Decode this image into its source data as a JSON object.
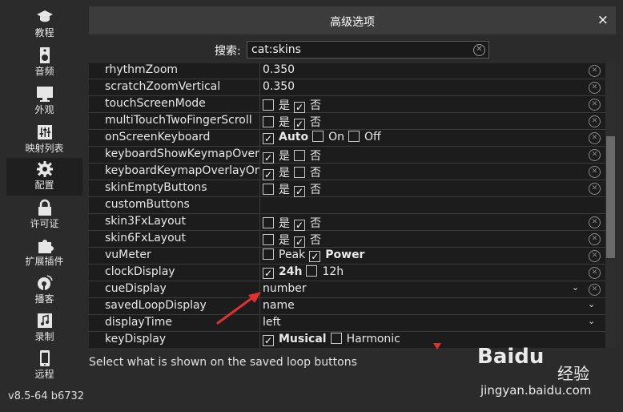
{
  "sidebar": {
    "items": [
      {
        "label": "教程",
        "icon": "graduation-cap-icon"
      },
      {
        "label": "音频",
        "icon": "speaker-icon"
      },
      {
        "label": "外观",
        "icon": "monitor-icon"
      },
      {
        "label": "映射列表",
        "icon": "sliders-icon"
      },
      {
        "label": "配置",
        "icon": "gear-icon",
        "active": true
      },
      {
        "label": "许可证",
        "icon": "lock-icon"
      },
      {
        "label": "扩展插件",
        "icon": "puzzle-icon"
      },
      {
        "label": "播客",
        "icon": "podcast-icon"
      },
      {
        "label": "录制",
        "icon": "music-note-icon"
      },
      {
        "label": "远程",
        "icon": "phone-icon"
      }
    ],
    "version": "v8.5-64 b6732"
  },
  "dialog": {
    "title": "高级选项",
    "close": "×"
  },
  "search": {
    "label": "搜索:",
    "value": "cat:skins"
  },
  "rows": [
    {
      "name": "rhythmZoom",
      "value": "0.350",
      "clear": true
    },
    {
      "name": "scratchZoomVertical",
      "value": "0.350",
      "clear": true
    },
    {
      "name": "touchScreenMode",
      "yes": "是",
      "no": "否",
      "checked": "no",
      "clear": true
    },
    {
      "name": "multiTouchTwoFingerScroll",
      "yes": "是",
      "no": "否",
      "checked": "no",
      "clear": true
    },
    {
      "name": "onScreenKeyboard",
      "options": [
        "Auto",
        "On",
        "Off"
      ],
      "checked": "Auto",
      "clear": true
    },
    {
      "name": "keyboardShowKeymapOverlay",
      "yes": "是",
      "no": "否",
      "checked": "yes",
      "clear": true
    },
    {
      "name": "keyboardKeymapOverlayOnShift",
      "yes": "是",
      "no": "否",
      "checked": "yes",
      "clear": true
    },
    {
      "name": "skinEmptyButtons",
      "yes": "是",
      "no": "否",
      "checked": "no",
      "clear": true
    },
    {
      "name": "customButtons",
      "value": "",
      "clear": false
    },
    {
      "name": "skin3FxLayout",
      "yes": "是",
      "no": "否",
      "checked": "no",
      "clear": true
    },
    {
      "name": "skin6FxLayout",
      "yes": "是",
      "no": "否",
      "checked": "no",
      "clear": true
    },
    {
      "name": "vuMeter",
      "options": [
        "Peak",
        "Power"
      ],
      "checked": "Power",
      "clear": true
    },
    {
      "name": "clockDisplay",
      "options": [
        "24h",
        "12h"
      ],
      "checked": "24h",
      "clear": true
    },
    {
      "name": "cueDisplay",
      "dropdown": "number",
      "clear": true
    },
    {
      "name": "savedLoopDisplay",
      "dropdown": "name",
      "clear": false
    },
    {
      "name": "displayTime",
      "dropdown": "left",
      "clear": false
    },
    {
      "name": "keyDisplay",
      "options": [
        "Musical",
        "Harmonic"
      ],
      "checked": "Musical",
      "clear": false
    }
  ],
  "description": "Select what is shown on the saved loop buttons",
  "watermark": {
    "brand": "Baidu",
    "jingyan": "经验",
    "url": "jingyan.baidu.com"
  },
  "colors": {
    "background": "#2b2b2b",
    "table": "#1c1c1c",
    "titlebar": "#3c3c3c",
    "annotation": "#e03030"
  }
}
